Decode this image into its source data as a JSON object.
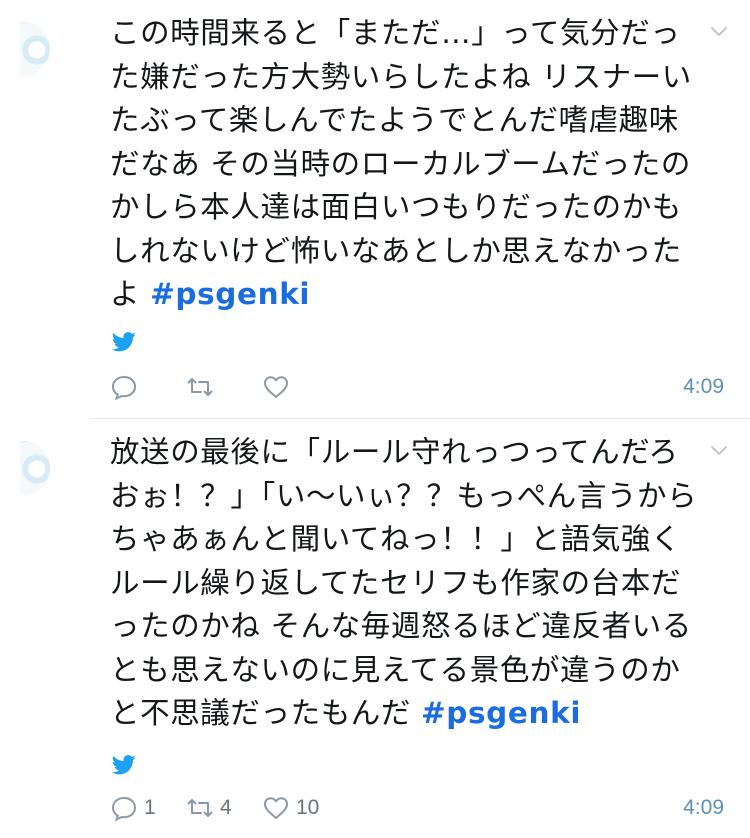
{
  "tweets": [
    {
      "text": "この時間来ると「まただ…」って気分だった嫌だった方大勢いらしたよね リスナーいたぶって楽しんでたようでとんだ嗜虐趣味だなあ その当時のローカルブームだったのかしら本人達は面白いつもりだったのかもしれないけど怖いなあとしか思えなかったよ ",
      "hashtag": "#psgenki",
      "time": "4:09",
      "reply_count": "",
      "retweet_count": "",
      "like_count": ""
    },
    {
      "text": "放送の最後に「ルール守れっつってんだろおぉ！？」「い〜いぃ？？もっぺん言うからちゃあぁんと聞いてねっ！！」と語気強くルール繰り返してたセリフも作家の台本だったのかね そんな毎週怒るほど違反者いるとも思えないのに見えてる景色が違うのかと不思議だったもんだ ",
      "hashtag": "#psgenki",
      "time": "4:09",
      "reply_count": "1",
      "retweet_count": "4",
      "like_count": "10"
    }
  ],
  "colors": {
    "hashtag": "#1b6ddf",
    "icon": "#8a99a6",
    "bird": "#1da1f2",
    "time": "#5b8fb5"
  },
  "icons": [
    "avatar",
    "chevron-down-icon",
    "twitter-bird-icon",
    "reply-icon",
    "retweet-icon",
    "like-icon"
  ]
}
